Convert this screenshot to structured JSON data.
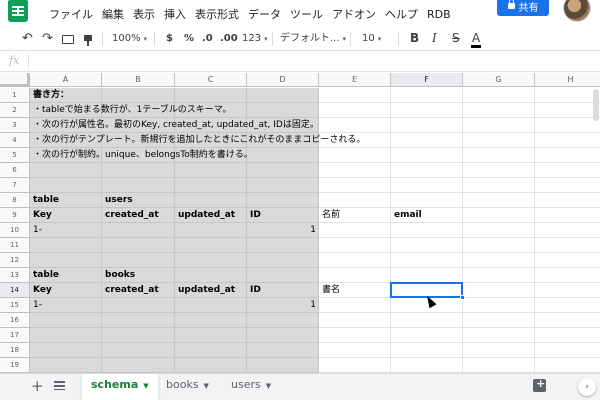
{
  "menu": [
    "ファイル",
    "編集",
    "表示",
    "挿入",
    "表示形式",
    "データ",
    "ツール",
    "アドオン",
    "ヘルプ",
    "RDB"
  ],
  "share_label": "共有",
  "toolbar": {
    "zoom": "100%",
    "currency": "$",
    "percent": "%",
    "decimal_decrease": ".0",
    "decimal_increase": ".00",
    "number_format": "123",
    "font": "デフォルト...",
    "font_size": "10",
    "bold": "B",
    "italic": "I",
    "strikethrough": "S",
    "text_color": "A"
  },
  "formula_bar": {
    "fx": "fx",
    "content": ""
  },
  "grid": {
    "columns": [
      "A",
      "B",
      "C",
      "D",
      "E",
      "F",
      "G",
      "H"
    ],
    "rows": [
      "1",
      "2",
      "3",
      "4",
      "5",
      "6",
      "7",
      "8",
      "9",
      "10",
      "11",
      "12",
      "13",
      "14",
      "15",
      "16",
      "17",
      "18",
      "19"
    ],
    "active_column": "F",
    "active_row": "14"
  },
  "cells": {
    "A1": "書き方：",
    "A2": "・tableで始まる数行が、1テーブルのスキーマ。",
    "A3": "・次の行が属性名。最初のKey, created_at, updated_at, IDは固定。",
    "A4": "・次の行がテンプレート。新規行を追加したときにこれがそのままコピーされる。",
    "A5": "・次の行が制約。unique、belongsTo制約を書ける。",
    "A8": "table",
    "B8": "users",
    "A9": "Key",
    "B9": "created_at",
    "C9": "updated_at",
    "D9": "ID",
    "E9": "名前",
    "F9": "email",
    "A10": "1-",
    "D10": "1",
    "A13": "table",
    "B13": "books",
    "A14": "Key",
    "B14": "created_at",
    "C14": "updated_at",
    "D14": "ID",
    "E14": "書名",
    "A15": "1-",
    "D15": "1"
  },
  "sheets": [
    "schema",
    "books",
    "users"
  ],
  "active_sheet": "schema",
  "colors": {
    "accent": "#1a73e8",
    "active_tab": "#188038",
    "template_fill": "#d9d9d9",
    "app_green": "#0f9d58"
  }
}
